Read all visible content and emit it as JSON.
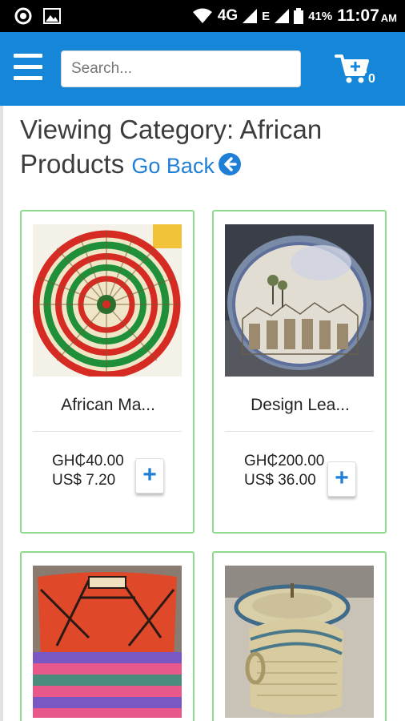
{
  "status_bar": {
    "network": "4G",
    "network_secondary": "E",
    "battery": "41%",
    "time": "11:07",
    "ampm": "AM"
  },
  "app_bar": {
    "search_placeholder": "Search...",
    "cart_count": "0",
    "accent_color": "#1687d8"
  },
  "page": {
    "heading_prefix": "Viewing Category: African Products",
    "go_back_label": "Go Back"
  },
  "products": [
    {
      "name": "African Ma...",
      "price_ghs": "GH₵40.00",
      "price_usd": "US$ 7.20",
      "add_label": "+"
    },
    {
      "name": "Design Lea...",
      "price_ghs": "GH₵200.00",
      "price_usd": "US$ 36.00",
      "add_label": "+"
    },
    {
      "name": "",
      "price_ghs": "",
      "price_usd": "",
      "add_label": "+"
    },
    {
      "name": "",
      "price_ghs": "",
      "price_usd": "",
      "add_label": "+"
    }
  ],
  "colors": {
    "card_border": "#8fdc8f",
    "link": "#1f7fd6"
  }
}
